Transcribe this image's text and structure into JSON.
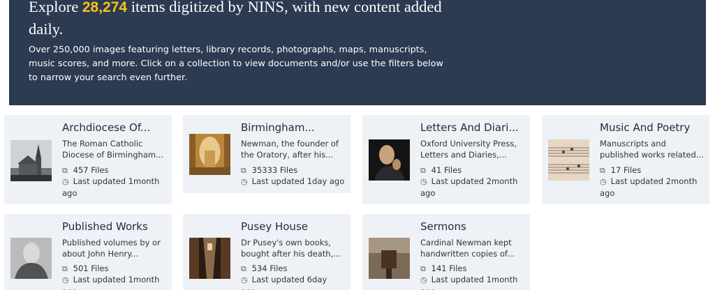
{
  "hero": {
    "title_prefix": "Explore",
    "count": "28,274",
    "title_suffix": "items digitized by NINS, with new content added daily.",
    "description": "Over 250,000 images featuring letters, library records, photographs, maps, manuscripts, music scores, and more. Click on a collection to view documents and/or use the filters below to narrow your search even further."
  },
  "collections": [
    {
      "title": "Archdiocese Of...",
      "desc1": "The Roman Catholic",
      "desc2": "Diocese of Birmingham...",
      "files": "457 Files",
      "updated": "Last updated 1month",
      "updated2": "ago",
      "thumb": "church-photo"
    },
    {
      "title": "Birmingham...",
      "desc1": "Newman, the founder of",
      "desc2": "the Oratory, after his...",
      "files": "35333 Files",
      "updated": "Last updated 1day ago",
      "updated2": "",
      "thumb": "oratory-interior-photo"
    },
    {
      "title": "Letters And Diari...",
      "desc1": "Oxford University Press,",
      "desc2": "Letters and Diaries,...",
      "files": "41 Files",
      "updated": "Last updated 2month",
      "updated2": "ago",
      "thumb": "newman-portrait"
    },
    {
      "title": "Music And Poetry",
      "desc1": "Manuscripts and",
      "desc2": "published works related...",
      "files": "17 Files",
      "updated": "Last updated 2month",
      "updated2": "ago",
      "thumb": "music-score"
    },
    {
      "title": "Published Works",
      "desc1": "Published volumes by or",
      "desc2": "about John Henry...",
      "files": "501 Files",
      "updated": "Last updated 1month",
      "updated2": "ago",
      "thumb": "elderly-newman-photo"
    },
    {
      "title": "Pusey House",
      "desc1": "Dr Pusey's own books,",
      "desc2": "bought after his death,...",
      "files": "534 Files",
      "updated": "Last updated 6day",
      "updated2": "ago",
      "thumb": "library-photo"
    },
    {
      "title": "Sermons",
      "desc1": "Cardinal Newman kept",
      "desc2": "handwritten copies of...",
      "files": "141 Files",
      "updated": "Last updated 1month",
      "updated2": "ago",
      "thumb": "pulpit-photo"
    }
  ],
  "icons": {
    "files": "files-icon",
    "clock": "clock-icon"
  }
}
